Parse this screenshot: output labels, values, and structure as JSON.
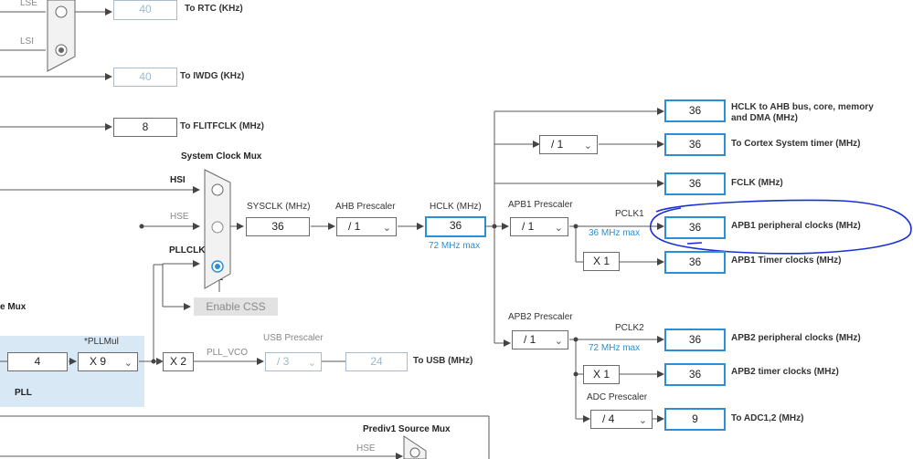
{
  "rtc": {
    "value": "40",
    "label": "To RTC (KHz)",
    "lse_label": "LSE",
    "lsi_label": "LSI"
  },
  "iwdg": {
    "value": "40",
    "label": "To IWDG (KHz)"
  },
  "flitf": {
    "value": "8",
    "label": "To FLITFCLK (MHz)"
  },
  "system_clock_mux": {
    "title": "System Clock Mux",
    "hsi": "HSI",
    "hse": "HSE",
    "pllclk": "PLLCLK",
    "selected": "PLLCLK"
  },
  "sysclk": {
    "label": "SYSCLK (MHz)",
    "value": "36"
  },
  "ahb_prescaler": {
    "label": "AHB Prescaler",
    "value": "/ 1"
  },
  "hclk": {
    "label": "HCLK (MHz)",
    "value": "36",
    "max": "72 MHz max"
  },
  "enable_css": {
    "label": "Enable CSS"
  },
  "pll": {
    "source_mux_label": "e Mux",
    "input": "4",
    "pllmul_label": "*PLLMul",
    "pllmul_value": "X 9",
    "label": "PLL"
  },
  "x2": {
    "value": "X 2"
  },
  "pll_vco": {
    "label": "PLL_VCO"
  },
  "usb": {
    "prescaler_label": "USB Prescaler",
    "prescaler_value": "/ 3",
    "value": "24",
    "label": "To USB (MHz)"
  },
  "prediv1": {
    "title": "Prediv1 Source Mux",
    "hse": "HSE"
  },
  "outputs": {
    "hclk_ahb": {
      "value": "36",
      "label": "HCLK to AHB bus, core, memory and DMA (MHz)"
    },
    "cortex_prescaler": "/ 1",
    "cortex": {
      "value": "36",
      "label": "To Cortex System timer (MHz)"
    },
    "fclk": {
      "value": "36",
      "label": "FCLK (MHz)"
    }
  },
  "apb1": {
    "prescaler_label": "APB1 Prescaler",
    "prescaler_value": "/ 1",
    "pclk_label": "PCLK1",
    "max": "36 MHz max",
    "periph_value": "36",
    "periph_label": "APB1 peripheral clocks (MHz)",
    "mult": "X 1",
    "timer_value": "36",
    "timer_label": "APB1 Timer clocks (MHz)"
  },
  "apb2": {
    "prescaler_label": "APB2 Prescaler",
    "prescaler_value": "/ 1",
    "pclk_label": "PCLK2",
    "max": "72 MHz max",
    "periph_value": "36",
    "periph_label": "APB2 peripheral clocks (MHz)",
    "mult": "X 1",
    "timer_value": "36",
    "timer_label": "APB2 timer clocks (MHz)"
  },
  "adc": {
    "prescaler_label": "ADC Prescaler",
    "prescaler_value": "/ 4",
    "value": "9",
    "label": "To ADC1,2 (MHz)"
  },
  "colors": {
    "accent": "#2c8fd6",
    "annotation": "#1a2fd8",
    "pll_bg": "#d8e8f5",
    "wire": "#5a5a5a"
  },
  "icons": {
    "dropdown": "chevron-down-icon",
    "radio": "radio-icon"
  }
}
